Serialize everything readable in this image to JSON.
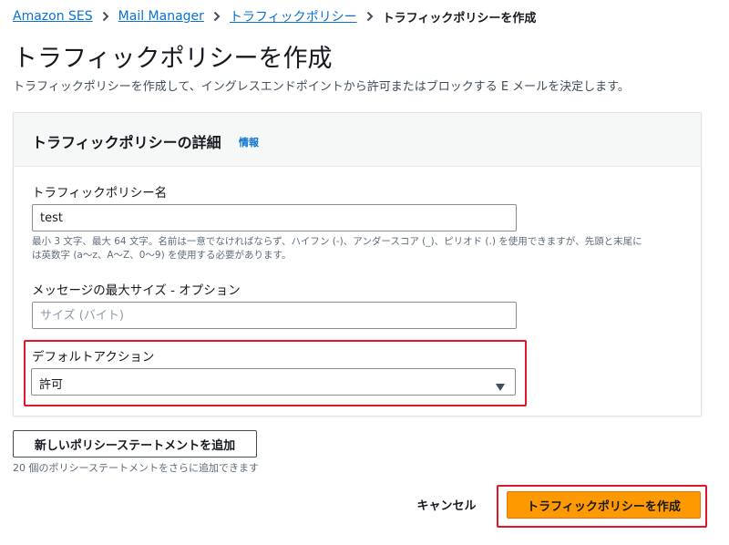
{
  "breadcrumb": {
    "items": [
      "Amazon SES",
      "Mail Manager",
      "トラフィックポリシー"
    ],
    "current": "トラフィックポリシーを作成"
  },
  "page": {
    "title": "トラフィックポリシーを作成",
    "description": "トラフィックポリシーを作成して、イングレスエンドポイントから許可またはブロックする E メールを決定します。"
  },
  "panel": {
    "title": "トラフィックポリシーの詳細",
    "info_link": "情報"
  },
  "form": {
    "policy_name": {
      "label": "トラフィックポリシー名",
      "value": "test",
      "hint_line1": "最小 3 文字、最大 64 文字。名前は一意でなければならず、ハイフン (-)、アンダースコア (_)、ピリオド (.) を使用できますが、先頭と末尾に",
      "hint_line2": "は英数字 (a〜z、A〜Z、0〜9) を使用する必要があります。"
    },
    "max_message_size": {
      "label": "メッセージの最大サイズ - オプション",
      "value": "",
      "placeholder": "サイズ (バイト)"
    },
    "default_action": {
      "label": "デフォルトアクション",
      "selected": "許可"
    }
  },
  "actions": {
    "add_statement_label": "新しいポリシーステートメントを追加",
    "add_statement_hint": "20 個のポリシーステートメントをさらに追加できます",
    "cancel_label": "キャンセル",
    "create_label": "トラフィックポリシーを作成"
  },
  "colors": {
    "link": "#0972d3",
    "primary_button": "#ff9900",
    "highlight": "#e0162b"
  },
  "icons": {
    "breadcrumb_separator": "chevron-right-icon",
    "select_caret": "caret-down-icon"
  }
}
